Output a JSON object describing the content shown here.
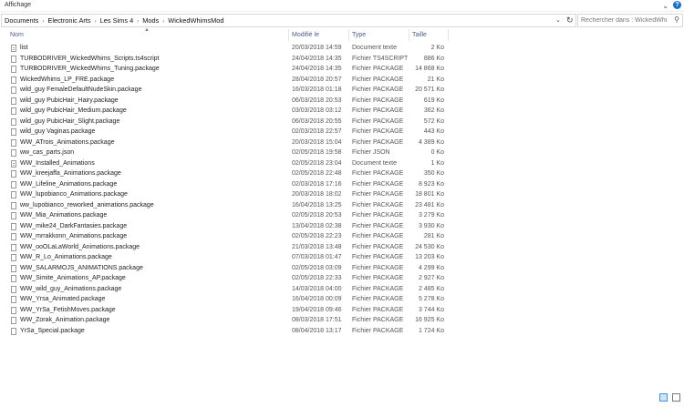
{
  "ribbon": {
    "title": "Affichage"
  },
  "breadcrumbs": [
    "Documents",
    "Electronic Arts",
    "Les Sims 4",
    "Mods",
    "WickedWhimsMod"
  ],
  "search": {
    "placeholder": "Rechercher dans : WickedWhi..."
  },
  "columns": {
    "name": "Nom",
    "date": "Modifié le",
    "type": "Type",
    "size": "Taille"
  },
  "files": [
    {
      "name": "list",
      "date": "20/03/2018 14:59",
      "type": "Document texte",
      "size": "2 Ko",
      "icon": "txt"
    },
    {
      "name": "TURBODRIVER_WickedWhims_Scripts.ts4script",
      "date": "24/04/2018 14:35",
      "type": "Fichier TS4SCRIPT",
      "size": "886 Ko",
      "icon": "file"
    },
    {
      "name": "TURBODRIVER_WickedWhims_Tuning.package",
      "date": "24/04/2018 14:35",
      "type": "Fichier PACKAGE",
      "size": "14 868 Ko",
      "icon": "file"
    },
    {
      "name": "WickedWhims_LP_FRE.package",
      "date": "28/04/2018 20:57",
      "type": "Fichier PACKAGE",
      "size": "21 Ko",
      "icon": "file"
    },
    {
      "name": "wild_guy FemaleDefaultNudeSkin.package",
      "date": "16/03/2018 01:18",
      "type": "Fichier PACKAGE",
      "size": "20 571 Ko",
      "icon": "file"
    },
    {
      "name": "wild_guy PubicHair_Hairy.package",
      "date": "06/03/2018 20:53",
      "type": "Fichier PACKAGE",
      "size": "619 Ko",
      "icon": "file"
    },
    {
      "name": "wild_guy PubicHair_Medium.package",
      "date": "03/03/2018 03:12",
      "type": "Fichier PACKAGE",
      "size": "362 Ko",
      "icon": "file"
    },
    {
      "name": "wild_guy PubicHair_Slight.package",
      "date": "06/03/2018 20:55",
      "type": "Fichier PACKAGE",
      "size": "572 Ko",
      "icon": "file"
    },
    {
      "name": "wild_guy Vaginas.package",
      "date": "02/03/2018 22:57",
      "type": "Fichier PACKAGE",
      "size": "443 Ko",
      "icon": "file"
    },
    {
      "name": "WW_ATrois_Animations.package",
      "date": "20/03/2018 15:04",
      "type": "Fichier PACKAGE",
      "size": "4 389 Ko",
      "icon": "file"
    },
    {
      "name": "ww_cas_parts.json",
      "date": "02/05/2018 19:58",
      "type": "Fichier JSON",
      "size": "0 Ko",
      "icon": "file"
    },
    {
      "name": "WW_Installed_Animations",
      "date": "02/05/2018 23:04",
      "type": "Document texte",
      "size": "1 Ko",
      "icon": "txt"
    },
    {
      "name": "WW_kreejaffa_Animations.package",
      "date": "02/05/2018 22:48",
      "type": "Fichier PACKAGE",
      "size": "350 Ko",
      "icon": "file"
    },
    {
      "name": "WW_Lifeline_Animations.package",
      "date": "02/03/2018 17:16",
      "type": "Fichier PACKAGE",
      "size": "8 923 Ko",
      "icon": "file"
    },
    {
      "name": "WW_lupobianco_Animations.package",
      "date": "20/03/2018 18:02",
      "type": "Fichier PACKAGE",
      "size": "18 801 Ko",
      "icon": "file"
    },
    {
      "name": "ww_lupobianco_reworked_animations.package",
      "date": "16/04/2018 13:25",
      "type": "Fichier PACKAGE",
      "size": "23 481 Ko",
      "icon": "file"
    },
    {
      "name": "WW_Mia_Animations.package",
      "date": "02/05/2018 20:53",
      "type": "Fichier PACKAGE",
      "size": "3 279 Ko",
      "icon": "file"
    },
    {
      "name": "WW_mike24_DarkFantasies.package",
      "date": "13/04/2018 02:38",
      "type": "Fichier PACKAGE",
      "size": "3 930 Ko",
      "icon": "file"
    },
    {
      "name": "WW_mrrakkonn_Animations.package",
      "date": "02/05/2018 22:23",
      "type": "Fichier PACKAGE",
      "size": "281 Ko",
      "icon": "file"
    },
    {
      "name": "WW_ooOLaLaWorld_Animations.package",
      "date": "21/03/2018 13:48",
      "type": "Fichier PACKAGE",
      "size": "24 530 Ko",
      "icon": "file"
    },
    {
      "name": "WW_R_Lo_Animations.package",
      "date": "07/03/2018 01:47",
      "type": "Fichier PACKAGE",
      "size": "13 203 Ko",
      "icon": "file"
    },
    {
      "name": "WW_SALARMOJS_ANIMATIONS.package",
      "date": "02/05/2018 03:09",
      "type": "Fichier PACKAGE",
      "size": "4 299 Ko",
      "icon": "file"
    },
    {
      "name": "WW_Simite_Animations_AP.package",
      "date": "02/05/2018 22:33",
      "type": "Fichier PACKAGE",
      "size": "2 927 Ko",
      "icon": "file"
    },
    {
      "name": "WW_wild_guy_Animations.package",
      "date": "14/03/2018 04:00",
      "type": "Fichier PACKAGE",
      "size": "2 485 Ko",
      "icon": "file"
    },
    {
      "name": "WW_Yrsa_Animated.package",
      "date": "16/04/2018 00:09",
      "type": "Fichier PACKAGE",
      "size": "5 278 Ko",
      "icon": "file"
    },
    {
      "name": "WW_YrSa_FetishMoves.package",
      "date": "19/04/2018 09:46",
      "type": "Fichier PACKAGE",
      "size": "3 744 Ko",
      "icon": "file"
    },
    {
      "name": "WW_Zorak_Animation.package",
      "date": "08/03/2018 17:51",
      "type": "Fichier PACKAGE",
      "size": "16 925 Ko",
      "icon": "file"
    },
    {
      "name": "YrSa_Special.package",
      "date": "08/04/2018 13:17",
      "type": "Fichier PACKAGE",
      "size": "1 724 Ko",
      "icon": "file"
    }
  ]
}
